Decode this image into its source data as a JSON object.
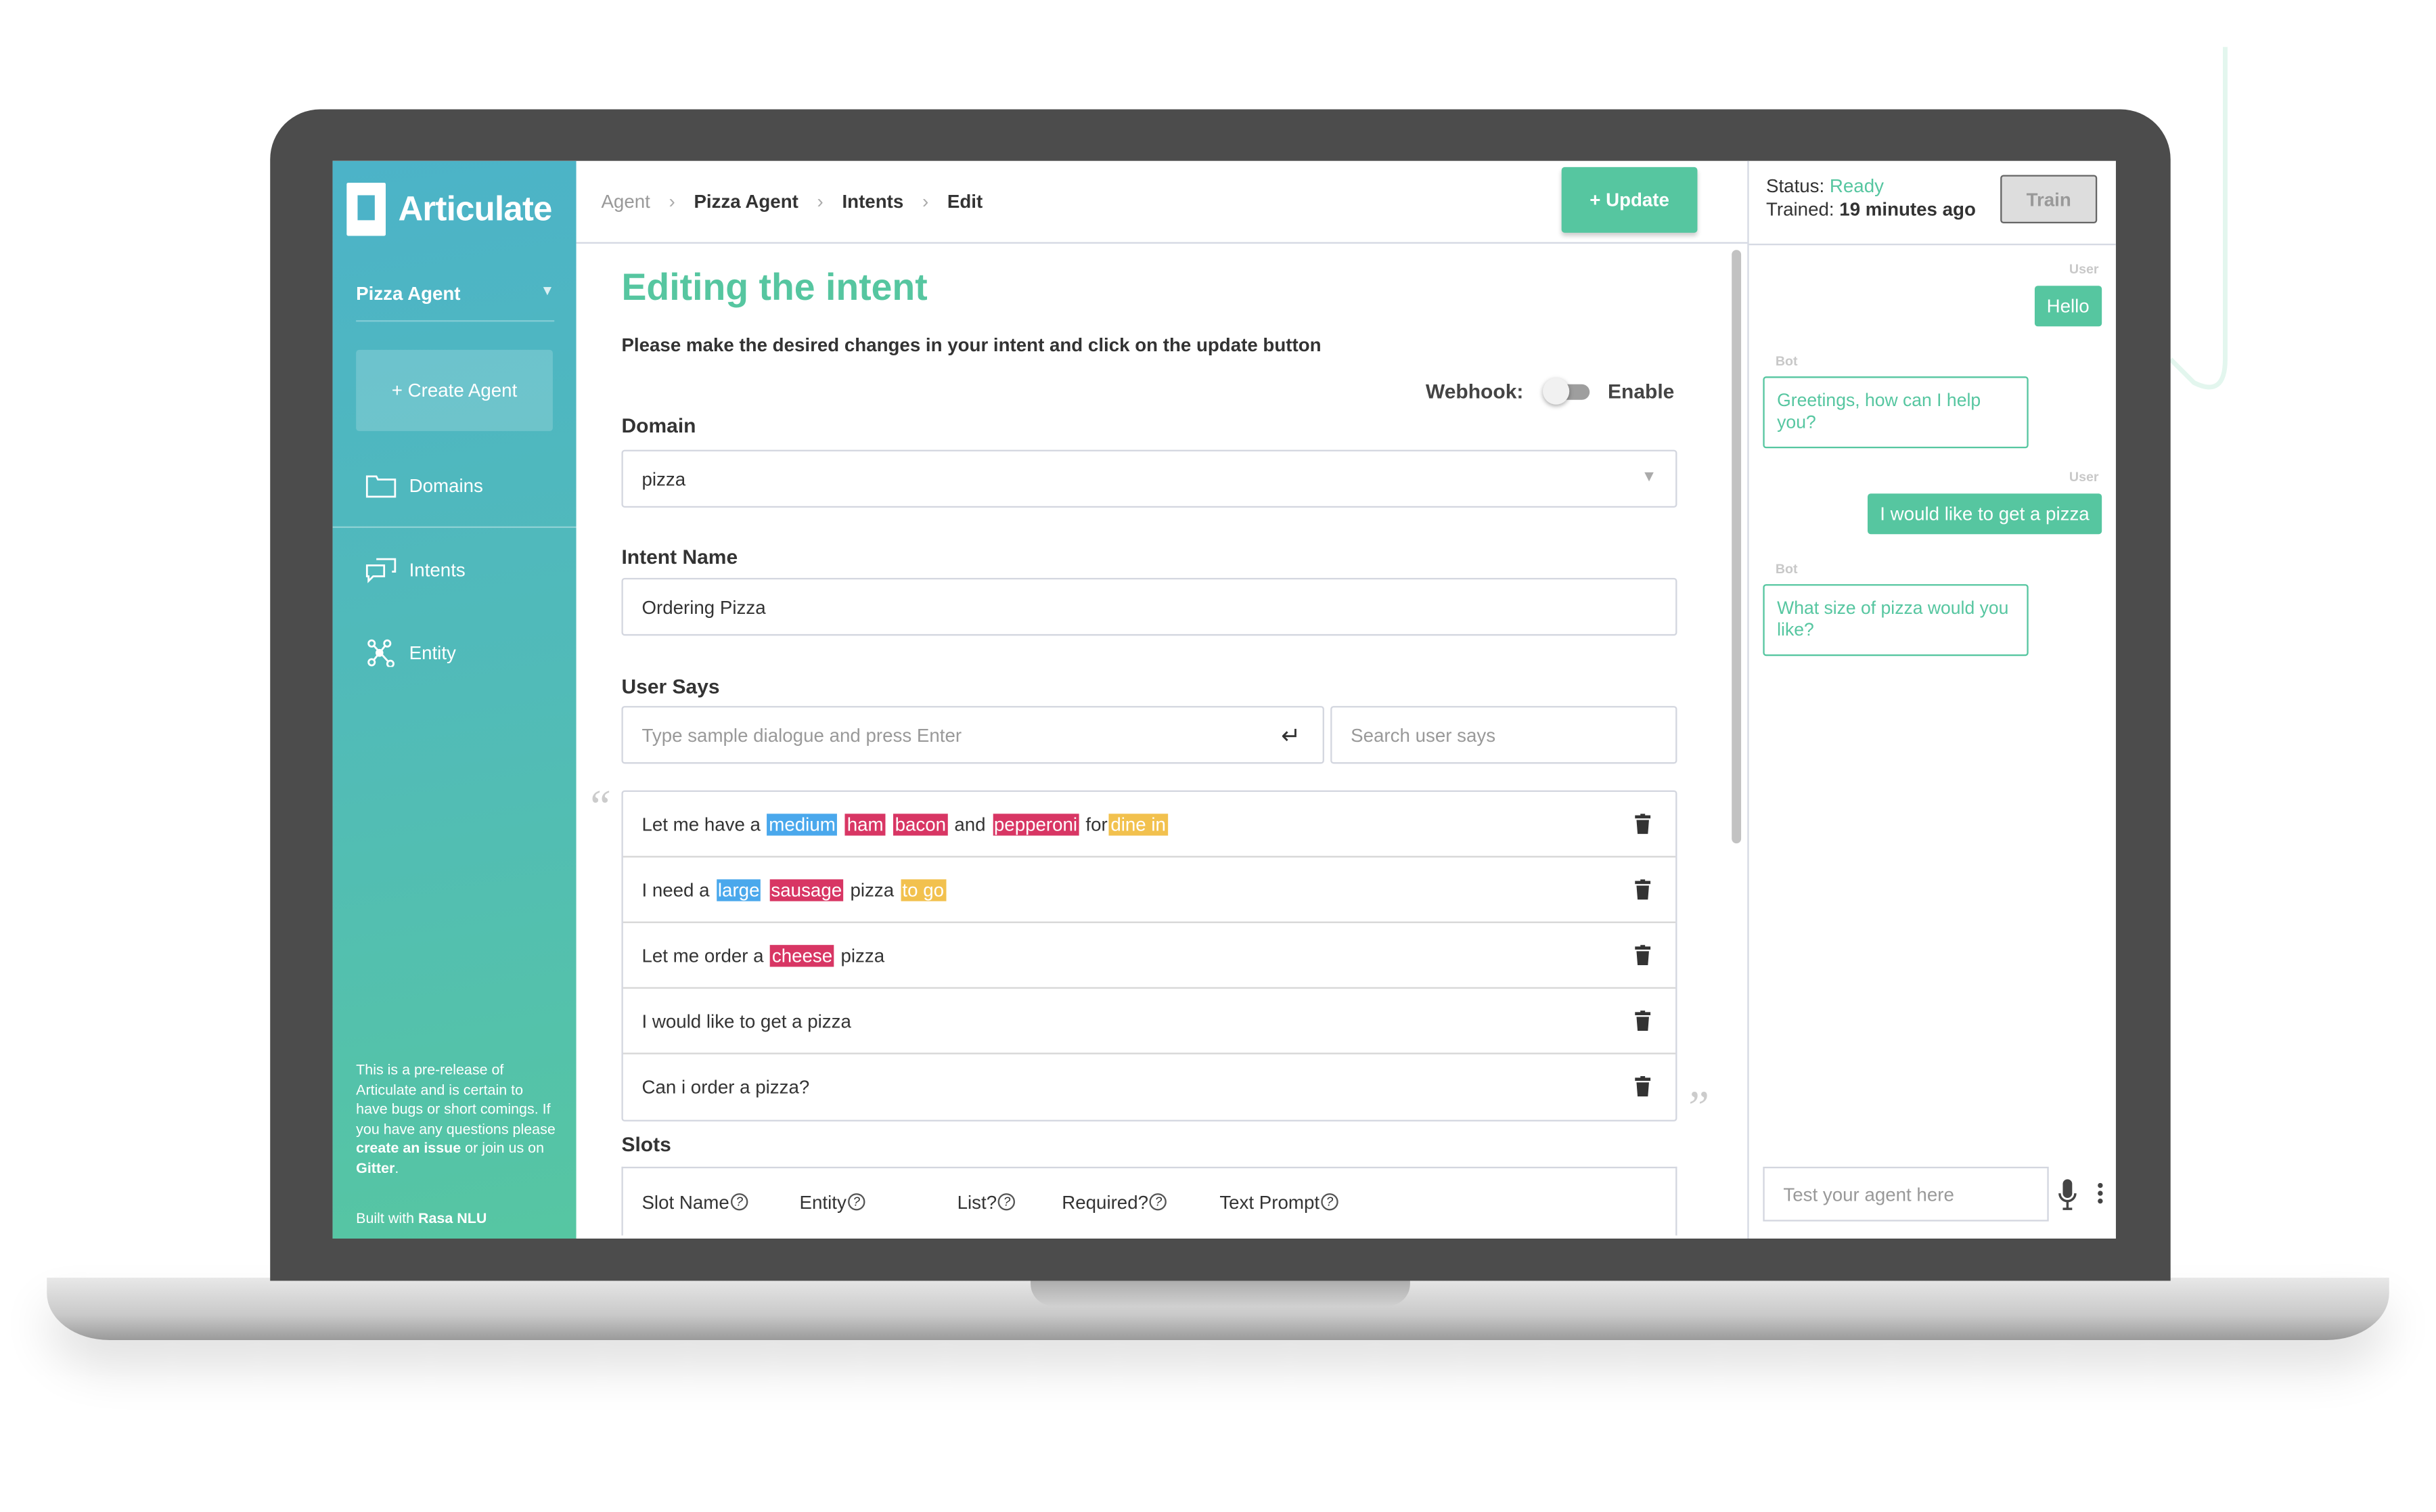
{
  "colors": {
    "accent": "#56c6a0",
    "entity_size": "#4aa8ec",
    "entity_topping": "#d83664",
    "entity_order_type": "#f2c14e"
  },
  "app": {
    "name": "Articulate"
  },
  "sidebar": {
    "agent_selector": "Pizza Agent",
    "create_agent": "+ Create Agent",
    "items": [
      {
        "label": "Domains",
        "icon": "folder-icon"
      },
      {
        "label": "Intents",
        "icon": "chat-bubbles-icon"
      },
      {
        "label": "Entity",
        "icon": "network-nodes-icon"
      }
    ],
    "notice": {
      "text1": "This is a pre-release of Articulate and is certain to have bugs or short comings. If you have any questions please ",
      "link1": "create an issue",
      "text2": " or join us on ",
      "link2": "Gitter",
      "text3": "."
    },
    "built_with": "Built with ",
    "built_with_link": "Rasa NLU"
  },
  "header": {
    "breadcrumbs": [
      "Agent",
      "Pizza Agent",
      "Intents",
      "Edit"
    ],
    "update_button": "+ Update"
  },
  "form": {
    "title": "Editing the intent",
    "subtitle": "Please make the desired changes in your intent and click on the update button",
    "webhook_label": "Webhook:",
    "webhook_enabled": false,
    "webhook_toggle_label": "Enable",
    "domain_label": "Domain",
    "domain_value": "pizza",
    "intent_name_label": "Intent Name",
    "intent_name_value": "Ordering Pizza",
    "user_says_label": "User Says",
    "user_says_placeholder": "Type sample dialogue and press Enter",
    "search_placeholder": "Search user says",
    "examples": [
      [
        {
          "t": "Let me have a "
        },
        {
          "t": "medium",
          "e": "size"
        },
        {
          "t": " "
        },
        {
          "t": "ham",
          "e": "topping"
        },
        {
          "t": " "
        },
        {
          "t": "bacon",
          "e": "topping"
        },
        {
          "t": " and "
        },
        {
          "t": "pepperoni",
          "e": "topping"
        },
        {
          "t": " for"
        },
        {
          "t": "dine in",
          "e": "order_type"
        }
      ],
      [
        {
          "t": "I need a "
        },
        {
          "t": "large",
          "e": "size"
        },
        {
          "t": " "
        },
        {
          "t": "sausage",
          "e": "topping"
        },
        {
          "t": " pizza "
        },
        {
          "t": "to go",
          "e": "order_type"
        }
      ],
      [
        {
          "t": "Let me order a "
        },
        {
          "t": "cheese",
          "e": "topping"
        },
        {
          "t": " pizza"
        }
      ],
      [
        {
          "t": "I would like to get a pizza"
        }
      ],
      [
        {
          "t": "Can i order a pizza?"
        }
      ]
    ],
    "slots_label": "Slots",
    "slot_columns": [
      "Slot Name",
      "Entity",
      "List?",
      "Required?",
      "Text Prompt"
    ]
  },
  "chat": {
    "status_label": "Status: ",
    "status_value": "Ready",
    "trained_label": "Trained: ",
    "trained_value": "19 minutes ago",
    "train_button": "Train",
    "messages": [
      {
        "who": "User",
        "text": "Hello"
      },
      {
        "who": "Bot",
        "text": "Greetings, how can I help you?"
      },
      {
        "who": "User",
        "text": "I would like to get a pizza"
      },
      {
        "who": "Bot",
        "text": "What size of pizza would you like?"
      }
    ],
    "input_placeholder": "Test your agent here"
  }
}
